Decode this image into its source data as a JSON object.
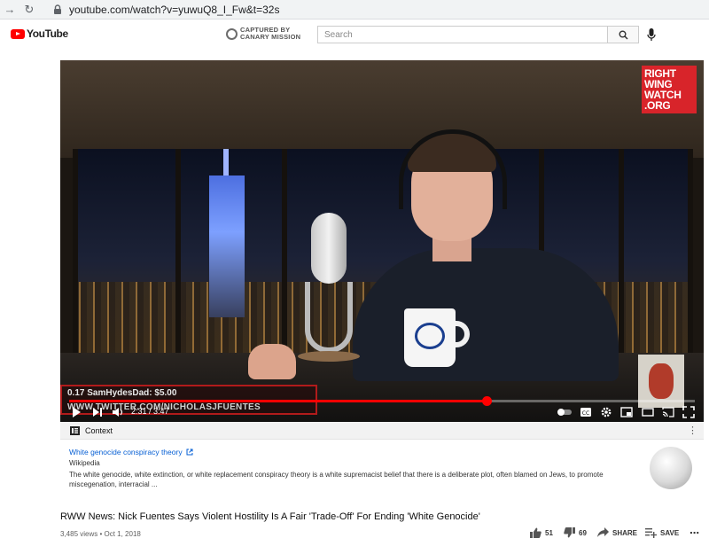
{
  "browser": {
    "url": "youtube.com/watch?v=yuwuQ8_I_Fw&t=32s"
  },
  "header": {
    "logo_text": "YouTube",
    "captured_line1": "CAPTURED BY",
    "captured_line2": "CANARY MISSION",
    "search_placeholder": "Search"
  },
  "video": {
    "rww_line1": "RIGHT",
    "rww_line2": "WING",
    "rww_line3": "WATCH",
    "rww_line4": ".ORG",
    "overlay_top": "0.17   SamHydesDad: $5.00",
    "overlay_bottom": "WWW.TWITTER.COM/NICHOLASJFUENTES",
    "time": "2:31 / 3:47",
    "progress_fraction": 0.667
  },
  "context": {
    "label": "Context"
  },
  "wiki": {
    "title": "White genocide conspiracy theory",
    "source": "Wikipedia",
    "description": "The white genocide, white extinction, or white replacement conspiracy theory is a white supremacist belief that there is a deliberate plot, often blamed on Jews, to promote miscegenation, interracial ..."
  },
  "info": {
    "title": "RWW News: Nick Fuentes Says Violent Hostility Is A Fair 'Trade-Off' For Ending 'White Genocide'",
    "meta": "3,485 views • Oct 1, 2018",
    "likes": "51",
    "dislikes": "69",
    "share_label": "SHARE",
    "save_label": "SAVE"
  },
  "colors": {
    "brand_red": "#ff0000",
    "link_blue": "#065fd4",
    "rww_red": "#d8242a"
  }
}
